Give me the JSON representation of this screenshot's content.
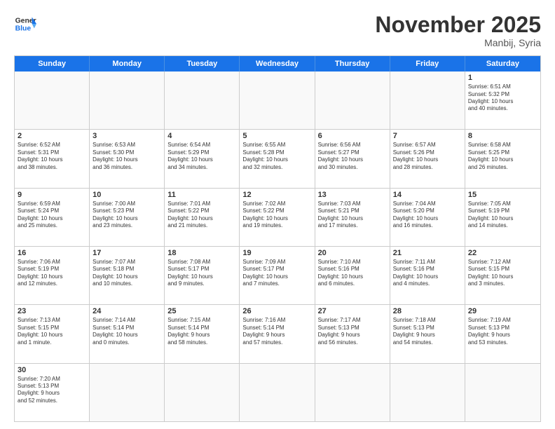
{
  "header": {
    "logo_general": "General",
    "logo_blue": "Blue",
    "month_title": "November 2025",
    "location": "Manbij, Syria"
  },
  "days_of_week": [
    "Sunday",
    "Monday",
    "Tuesday",
    "Wednesday",
    "Thursday",
    "Friday",
    "Saturday"
  ],
  "weeks": [
    [
      {
        "day": "",
        "text": ""
      },
      {
        "day": "",
        "text": ""
      },
      {
        "day": "",
        "text": ""
      },
      {
        "day": "",
        "text": ""
      },
      {
        "day": "",
        "text": ""
      },
      {
        "day": "",
        "text": ""
      },
      {
        "day": "1",
        "text": "Sunrise: 6:51 AM\nSunset: 5:32 PM\nDaylight: 10 hours\nand 40 minutes."
      }
    ],
    [
      {
        "day": "2",
        "text": "Sunrise: 6:52 AM\nSunset: 5:31 PM\nDaylight: 10 hours\nand 38 minutes."
      },
      {
        "day": "3",
        "text": "Sunrise: 6:53 AM\nSunset: 5:30 PM\nDaylight: 10 hours\nand 36 minutes."
      },
      {
        "day": "4",
        "text": "Sunrise: 6:54 AM\nSunset: 5:29 PM\nDaylight: 10 hours\nand 34 minutes."
      },
      {
        "day": "5",
        "text": "Sunrise: 6:55 AM\nSunset: 5:28 PM\nDaylight: 10 hours\nand 32 minutes."
      },
      {
        "day": "6",
        "text": "Sunrise: 6:56 AM\nSunset: 5:27 PM\nDaylight: 10 hours\nand 30 minutes."
      },
      {
        "day": "7",
        "text": "Sunrise: 6:57 AM\nSunset: 5:26 PM\nDaylight: 10 hours\nand 28 minutes."
      },
      {
        "day": "8",
        "text": "Sunrise: 6:58 AM\nSunset: 5:25 PM\nDaylight: 10 hours\nand 26 minutes."
      }
    ],
    [
      {
        "day": "9",
        "text": "Sunrise: 6:59 AM\nSunset: 5:24 PM\nDaylight: 10 hours\nand 25 minutes."
      },
      {
        "day": "10",
        "text": "Sunrise: 7:00 AM\nSunset: 5:23 PM\nDaylight: 10 hours\nand 23 minutes."
      },
      {
        "day": "11",
        "text": "Sunrise: 7:01 AM\nSunset: 5:22 PM\nDaylight: 10 hours\nand 21 minutes."
      },
      {
        "day": "12",
        "text": "Sunrise: 7:02 AM\nSunset: 5:22 PM\nDaylight: 10 hours\nand 19 minutes."
      },
      {
        "day": "13",
        "text": "Sunrise: 7:03 AM\nSunset: 5:21 PM\nDaylight: 10 hours\nand 17 minutes."
      },
      {
        "day": "14",
        "text": "Sunrise: 7:04 AM\nSunset: 5:20 PM\nDaylight: 10 hours\nand 16 minutes."
      },
      {
        "day": "15",
        "text": "Sunrise: 7:05 AM\nSunset: 5:19 PM\nDaylight: 10 hours\nand 14 minutes."
      }
    ],
    [
      {
        "day": "16",
        "text": "Sunrise: 7:06 AM\nSunset: 5:19 PM\nDaylight: 10 hours\nand 12 minutes."
      },
      {
        "day": "17",
        "text": "Sunrise: 7:07 AM\nSunset: 5:18 PM\nDaylight: 10 hours\nand 10 minutes."
      },
      {
        "day": "18",
        "text": "Sunrise: 7:08 AM\nSunset: 5:17 PM\nDaylight: 10 hours\nand 9 minutes."
      },
      {
        "day": "19",
        "text": "Sunrise: 7:09 AM\nSunset: 5:17 PM\nDaylight: 10 hours\nand 7 minutes."
      },
      {
        "day": "20",
        "text": "Sunrise: 7:10 AM\nSunset: 5:16 PM\nDaylight: 10 hours\nand 6 minutes."
      },
      {
        "day": "21",
        "text": "Sunrise: 7:11 AM\nSunset: 5:16 PM\nDaylight: 10 hours\nand 4 minutes."
      },
      {
        "day": "22",
        "text": "Sunrise: 7:12 AM\nSunset: 5:15 PM\nDaylight: 10 hours\nand 3 minutes."
      }
    ],
    [
      {
        "day": "23",
        "text": "Sunrise: 7:13 AM\nSunset: 5:15 PM\nDaylight: 10 hours\nand 1 minute."
      },
      {
        "day": "24",
        "text": "Sunrise: 7:14 AM\nSunset: 5:14 PM\nDaylight: 10 hours\nand 0 minutes."
      },
      {
        "day": "25",
        "text": "Sunrise: 7:15 AM\nSunset: 5:14 PM\nDaylight: 9 hours\nand 58 minutes."
      },
      {
        "day": "26",
        "text": "Sunrise: 7:16 AM\nSunset: 5:14 PM\nDaylight: 9 hours\nand 57 minutes."
      },
      {
        "day": "27",
        "text": "Sunrise: 7:17 AM\nSunset: 5:13 PM\nDaylight: 9 hours\nand 56 minutes."
      },
      {
        "day": "28",
        "text": "Sunrise: 7:18 AM\nSunset: 5:13 PM\nDaylight: 9 hours\nand 54 minutes."
      },
      {
        "day": "29",
        "text": "Sunrise: 7:19 AM\nSunset: 5:13 PM\nDaylight: 9 hours\nand 53 minutes."
      }
    ],
    [
      {
        "day": "30",
        "text": "Sunrise: 7:20 AM\nSunset: 5:13 PM\nDaylight: 9 hours\nand 52 minutes."
      },
      {
        "day": "",
        "text": ""
      },
      {
        "day": "",
        "text": ""
      },
      {
        "day": "",
        "text": ""
      },
      {
        "day": "",
        "text": ""
      },
      {
        "day": "",
        "text": ""
      },
      {
        "day": "",
        "text": ""
      }
    ]
  ]
}
